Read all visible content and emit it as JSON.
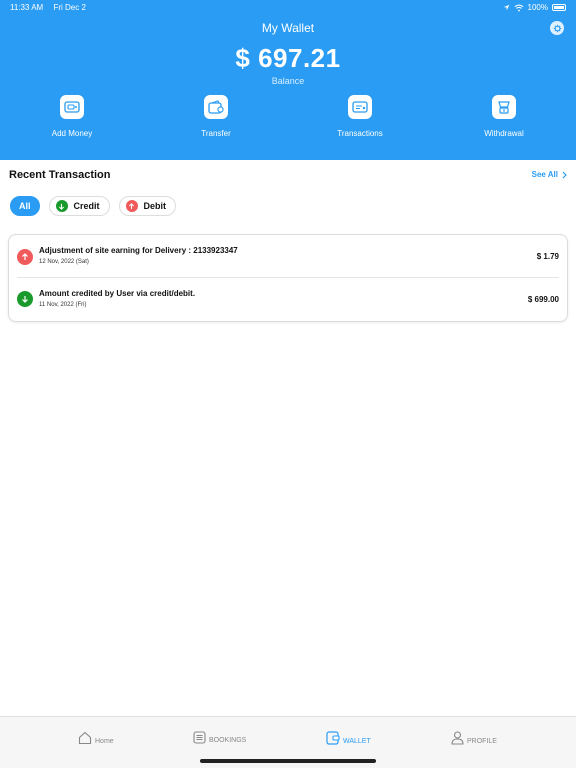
{
  "status_bar": {
    "time": "11:33 AM",
    "date": "Fri Dec 2",
    "battery": "100%"
  },
  "header": {
    "title": "My Wallet",
    "balance": "$ 697.21",
    "balance_label": "Balance",
    "actions": [
      {
        "label": "Add Money",
        "icon": "wallet-add-icon"
      },
      {
        "label": "Transfer",
        "icon": "wallet-transfer-icon"
      },
      {
        "label": "Transactions",
        "icon": "transactions-icon"
      },
      {
        "label": "Withdrawal",
        "icon": "withdraw-icon"
      }
    ]
  },
  "recent": {
    "title": "Recent Transaction",
    "see_all": "See All",
    "filters": [
      {
        "label": "All",
        "active": true
      },
      {
        "label": "Credit",
        "active": false
      },
      {
        "label": "Debit",
        "active": false
      }
    ],
    "transactions": [
      {
        "description": "Adjustment of site earning for Delivery : 2133923347",
        "date": "12 Nov, 2022 (Sat)",
        "amount": "$ 1.79",
        "type": "debit"
      },
      {
        "description": "Amount credited by User via credit/debit.",
        "date": "11 Nov, 2022 (Fri)",
        "amount": "$ 699.00",
        "type": "credit"
      }
    ]
  },
  "tabs": [
    {
      "label": "Home",
      "icon": "home-icon",
      "active": false
    },
    {
      "label": "BOOKINGS",
      "icon": "bookings-icon",
      "active": false
    },
    {
      "label": "WALLET",
      "icon": "wallet-icon",
      "active": true
    },
    {
      "label": "PROFILE",
      "icon": "profile-icon",
      "active": false
    }
  ],
  "colors": {
    "primary": "#2a9cf4",
    "credit": "#1a9a2c",
    "debit": "#f05a5a"
  }
}
